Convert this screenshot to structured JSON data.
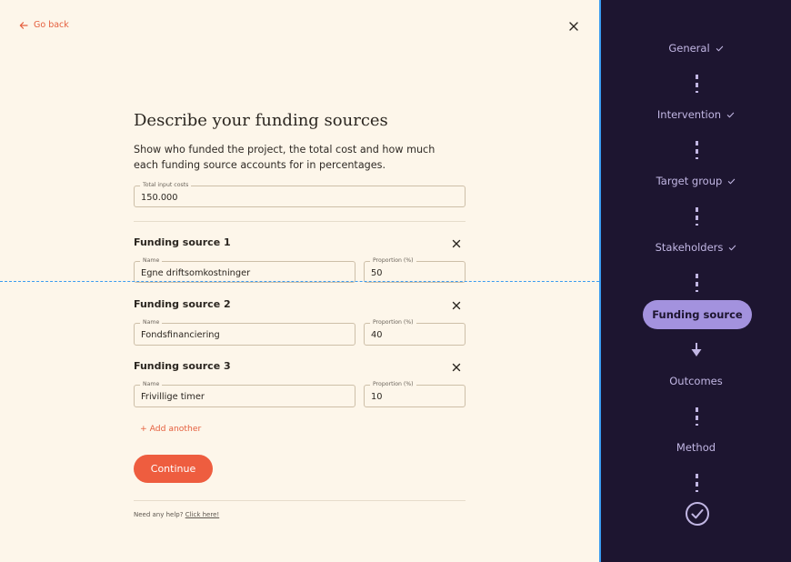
{
  "nav": {
    "back_label": "Go back"
  },
  "form": {
    "title": "Describe your funding sources",
    "description": "Show who funded the project, the total cost and how much each funding source accounts for in percentages.",
    "total": {
      "label": "Total input costs",
      "value": "150.000"
    },
    "sources": [
      {
        "title": "Funding source 1",
        "name_label": "Name",
        "name_value": "Egne driftsomkostninger",
        "prop_label": "Proportion (%)",
        "prop_value": "50"
      },
      {
        "title": "Funding source 2",
        "name_label": "Name",
        "name_value": "Fondsfinanciering",
        "prop_label": "Proportion (%)",
        "prop_value": "40"
      },
      {
        "title": "Funding source 3",
        "name_label": "Name",
        "name_value": "Frivillige timer",
        "prop_label": "Proportion (%)",
        "prop_value": "10"
      }
    ],
    "add_label": "+ Add another",
    "continue_label": "Continue",
    "help_text": "Need any help?",
    "help_link": "Click here!"
  },
  "steps": {
    "items": [
      {
        "label": "General",
        "status": "done"
      },
      {
        "label": "Intervention",
        "status": "done"
      },
      {
        "label": "Target group",
        "status": "done"
      },
      {
        "label": "Stakeholders",
        "status": "done"
      },
      {
        "label": "Funding source",
        "status": "current"
      },
      {
        "label": "Outcomes",
        "status": "pending"
      },
      {
        "label": "Method",
        "status": "pending"
      }
    ],
    "completion_icon": "check-circle-icon"
  },
  "colors": {
    "accent": "#ee5d3f",
    "sidebar_bg": "#1d1530",
    "sidebar_text": "#c1b6e3",
    "pill_bg": "#a392de",
    "page_bg": "#fdf6ea"
  }
}
